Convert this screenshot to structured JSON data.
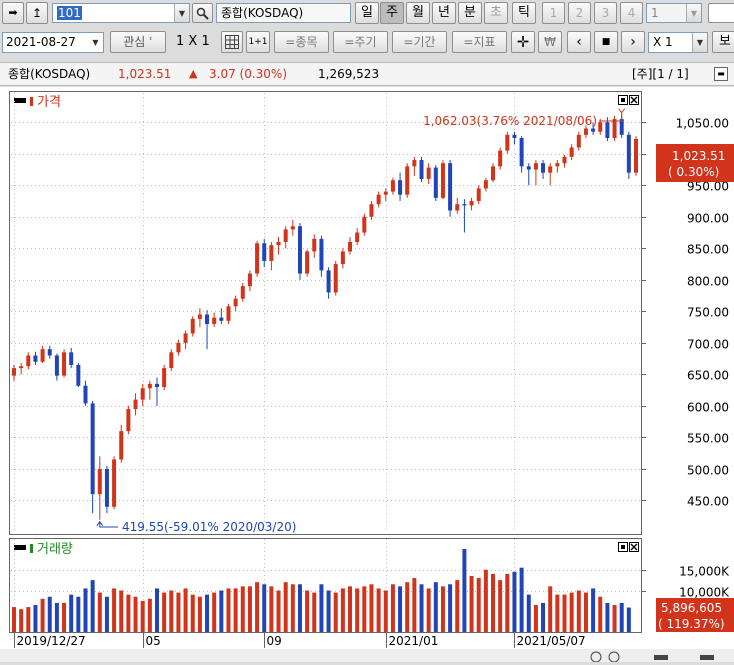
{
  "toolbar": {
    "code": "101",
    "index_name": "종합(KOSDAQ)",
    "periods": [
      "일",
      "주",
      "월",
      "년",
      "분",
      "초",
      "틱"
    ],
    "active_period": "주",
    "nums": [
      "1",
      "2",
      "3",
      "4"
    ],
    "count_value": "1",
    "right_label": "보"
  },
  "toolbar2": {
    "date": "2021-08-27",
    "watch_label": "관심",
    "layout_label": "1 X 1",
    "one_plus_one": "1+1",
    "stock_btn": "=종목",
    "cycle_btn": "=주기",
    "period_btn": "=기간",
    "indicator_btn": "=지표",
    "won_symbol": "₩",
    "zoom": "X 1"
  },
  "infobar": {
    "name": "종합(KOSDAQ)",
    "price": "1,023.51",
    "change_arrow": "▲",
    "change": "3.07 (0.30%)",
    "volume": "1,269,523",
    "right": "[주][1 / 1]"
  },
  "colors": {
    "up": "#d1331b",
    "down": "#1f45b8",
    "volume_label": "#228b22"
  },
  "price_panel": {
    "title": "가격",
    "current_price": "1,023.51",
    "current_change": "( 0.30%)",
    "high_annotation": "1,062.03(3.76% 2021/08/06)",
    "low_annotation": "419.55(-59.01% 2020/03/20)"
  },
  "volume_panel": {
    "title": "거래량",
    "current_volume": "5,896,605",
    "current_change": "( 119.37%)"
  },
  "chart_data": {
    "type": "candlestick",
    "period": "weekly",
    "price_ticks": [
      "1,050.00",
      "1,000.00",
      "950.00",
      "900.00",
      "850.00",
      "800.00",
      "750.00",
      "700.00",
      "650.00",
      "600.00",
      "550.00",
      "500.00",
      "450.00"
    ],
    "price_range": [
      400,
      1090
    ],
    "volume_ticks": [
      "15,000K",
      "10,000K"
    ],
    "volume_range": [
      0,
      20000
    ],
    "x_labels": [
      "2019/12/27",
      "05",
      "09",
      "2021/01",
      "2021/05/07"
    ],
    "candles": [
      {
        "o": 648,
        "h": 665,
        "l": 640,
        "c": 660
      },
      {
        "o": 660,
        "h": 668,
        "l": 650,
        "c": 663
      },
      {
        "o": 663,
        "h": 685,
        "l": 658,
        "c": 680
      },
      {
        "o": 680,
        "h": 686,
        "l": 665,
        "c": 670
      },
      {
        "o": 670,
        "h": 695,
        "l": 668,
        "c": 690
      },
      {
        "o": 690,
        "h": 695,
        "l": 675,
        "c": 680
      },
      {
        "o": 680,
        "h": 683,
        "l": 640,
        "c": 648
      },
      {
        "o": 648,
        "h": 690,
        "l": 645,
        "c": 685
      },
      {
        "o": 685,
        "h": 692,
        "l": 660,
        "c": 665
      },
      {
        "o": 665,
        "h": 668,
        "l": 630,
        "c": 632
      },
      {
        "o": 632,
        "h": 640,
        "l": 600,
        "c": 604
      },
      {
        "o": 604,
        "h": 608,
        "l": 430,
        "c": 460
      },
      {
        "o": 460,
        "h": 520,
        "l": 419.55,
        "c": 500
      },
      {
        "o": 500,
        "h": 505,
        "l": 430,
        "c": 440
      },
      {
        "o": 440,
        "h": 520,
        "l": 436,
        "c": 515
      },
      {
        "o": 515,
        "h": 570,
        "l": 510,
        "c": 560
      },
      {
        "o": 560,
        "h": 600,
        "l": 555,
        "c": 595
      },
      {
        "o": 595,
        "h": 620,
        "l": 585,
        "c": 610
      },
      {
        "o": 610,
        "h": 635,
        "l": 600,
        "c": 628
      },
      {
        "o": 628,
        "h": 640,
        "l": 610,
        "c": 635
      },
      {
        "o": 635,
        "h": 645,
        "l": 600,
        "c": 630
      },
      {
        "o": 630,
        "h": 665,
        "l": 625,
        "c": 660
      },
      {
        "o": 660,
        "h": 690,
        "l": 655,
        "c": 685
      },
      {
        "o": 685,
        "h": 705,
        "l": 680,
        "c": 700
      },
      {
        "o": 700,
        "h": 720,
        "l": 690,
        "c": 715
      },
      {
        "o": 715,
        "h": 742,
        "l": 710,
        "c": 738
      },
      {
        "o": 738,
        "h": 755,
        "l": 725,
        "c": 745
      },
      {
        "o": 745,
        "h": 752,
        "l": 690,
        "c": 730
      },
      {
        "o": 730,
        "h": 748,
        "l": 725,
        "c": 740
      },
      {
        "o": 740,
        "h": 755,
        "l": 730,
        "c": 735
      },
      {
        "o": 735,
        "h": 762,
        "l": 730,
        "c": 758
      },
      {
        "o": 758,
        "h": 775,
        "l": 750,
        "c": 770
      },
      {
        "o": 770,
        "h": 795,
        "l": 765,
        "c": 790
      },
      {
        "o": 790,
        "h": 815,
        "l": 782,
        "c": 810
      },
      {
        "o": 810,
        "h": 862,
        "l": 805,
        "c": 858
      },
      {
        "o": 858,
        "h": 865,
        "l": 820,
        "c": 830
      },
      {
        "o": 830,
        "h": 860,
        "l": 815,
        "c": 855
      },
      {
        "o": 855,
        "h": 868,
        "l": 840,
        "c": 860
      },
      {
        "o": 860,
        "h": 885,
        "l": 850,
        "c": 880
      },
      {
        "o": 880,
        "h": 895,
        "l": 870,
        "c": 885
      },
      {
        "o": 885,
        "h": 890,
        "l": 800,
        "c": 810
      },
      {
        "o": 810,
        "h": 848,
        "l": 805,
        "c": 845
      },
      {
        "o": 845,
        "h": 872,
        "l": 835,
        "c": 865
      },
      {
        "o": 865,
        "h": 870,
        "l": 805,
        "c": 815
      },
      {
        "o": 815,
        "h": 820,
        "l": 770,
        "c": 780
      },
      {
        "o": 780,
        "h": 830,
        "l": 775,
        "c": 825
      },
      {
        "o": 825,
        "h": 850,
        "l": 818,
        "c": 845
      },
      {
        "o": 845,
        "h": 868,
        "l": 840,
        "c": 860
      },
      {
        "o": 860,
        "h": 882,
        "l": 855,
        "c": 875
      },
      {
        "o": 875,
        "h": 905,
        "l": 870,
        "c": 900
      },
      {
        "o": 900,
        "h": 925,
        "l": 895,
        "c": 920
      },
      {
        "o": 920,
        "h": 940,
        "l": 915,
        "c": 935
      },
      {
        "o": 935,
        "h": 945,
        "l": 925,
        "c": 940
      },
      {
        "o": 940,
        "h": 962,
        "l": 935,
        "c": 958
      },
      {
        "o": 958,
        "h": 970,
        "l": 925,
        "c": 935
      },
      {
        "o": 935,
        "h": 985,
        "l": 930,
        "c": 980
      },
      {
        "o": 980,
        "h": 995,
        "l": 965,
        "c": 990
      },
      {
        "o": 990,
        "h": 995,
        "l": 955,
        "c": 960
      },
      {
        "o": 960,
        "h": 985,
        "l": 952,
        "c": 978
      },
      {
        "o": 978,
        "h": 982,
        "l": 925,
        "c": 930
      },
      {
        "o": 930,
        "h": 990,
        "l": 928,
        "c": 985
      },
      {
        "o": 985,
        "h": 990,
        "l": 900,
        "c": 910
      },
      {
        "o": 910,
        "h": 930,
        "l": 905,
        "c": 920
      },
      {
        "o": 920,
        "h": 928,
        "l": 875,
        "c": 918
      },
      {
        "o": 918,
        "h": 930,
        "l": 910,
        "c": 925
      },
      {
        "o": 925,
        "h": 950,
        "l": 920,
        "c": 945
      },
      {
        "o": 945,
        "h": 962,
        "l": 940,
        "c": 958
      },
      {
        "o": 958,
        "h": 985,
        "l": 955,
        "c": 980
      },
      {
        "o": 980,
        "h": 1010,
        "l": 975,
        "c": 1005
      },
      {
        "o": 1005,
        "h": 1035,
        "l": 1000,
        "c": 1030
      },
      {
        "o": 1030,
        "h": 1035,
        "l": 1015,
        "c": 1025
      },
      {
        "o": 1025,
        "h": 1028,
        "l": 970,
        "c": 980
      },
      {
        "o": 980,
        "h": 985,
        "l": 950,
        "c": 975
      },
      {
        "o": 975,
        "h": 990,
        "l": 950,
        "c": 985
      },
      {
        "o": 985,
        "h": 990,
        "l": 960,
        "c": 970
      },
      {
        "o": 970,
        "h": 985,
        "l": 950,
        "c": 980
      },
      {
        "o": 980,
        "h": 990,
        "l": 970,
        "c": 985
      },
      {
        "o": 985,
        "h": 998,
        "l": 978,
        "c": 995
      },
      {
        "o": 995,
        "h": 1015,
        "l": 990,
        "c": 1010
      },
      {
        "o": 1010,
        "h": 1035,
        "l": 1005,
        "c": 1030
      },
      {
        "o": 1030,
        "h": 1045,
        "l": 1025,
        "c": 1040
      },
      {
        "o": 1040,
        "h": 1050,
        "l": 1030,
        "c": 1035
      },
      {
        "o": 1035,
        "h": 1055,
        "l": 1030,
        "c": 1050
      },
      {
        "o": 1050,
        "h": 1058,
        "l": 1020,
        "c": 1025
      },
      {
        "o": 1025,
        "h": 1060,
        "l": 1020,
        "c": 1055
      },
      {
        "o": 1055,
        "h": 1062.03,
        "l": 1025,
        "c": 1030
      },
      {
        "o": 1030,
        "h": 1035,
        "l": 960,
        "c": 970
      },
      {
        "o": 970,
        "h": 1028,
        "l": 965,
        "c": 1023.51
      }
    ],
    "volumes": [
      6000,
      5500,
      6000,
      6500,
      8000,
      8500,
      7000,
      7000,
      9000,
      8500,
      10500,
      12500,
      9500,
      8500,
      10500,
      10000,
      9000,
      8500,
      7500,
      8000,
      10500,
      9500,
      10000,
      9500,
      10500,
      9000,
      8500,
      9000,
      9500,
      10000,
      10500,
      10500,
      11000,
      11000,
      12000,
      11500,
      11000,
      10000,
      12000,
      11500,
      11500,
      10000,
      9500,
      11500,
      10000,
      9500,
      10500,
      11000,
      10500,
      11000,
      11500,
      10500,
      10000,
      11500,
      11000,
      12000,
      13000,
      11500,
      10500,
      12000,
      11000,
      11500,
      12500,
      20000,
      13500,
      13000,
      15000,
      14000,
      12500,
      14000,
      14500,
      15500,
      9000,
      6500,
      7000,
      11000,
      9000,
      9000,
      9500,
      10000,
      9500,
      10500,
      8500,
      7000,
      6500,
      7000,
      5900
    ]
  }
}
